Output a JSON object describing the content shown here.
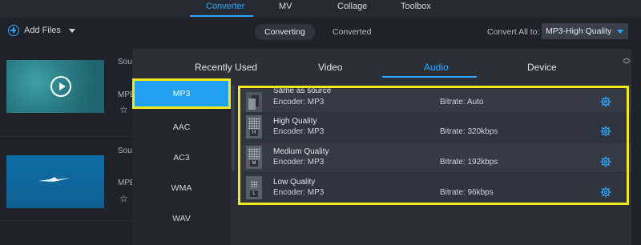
{
  "top_nav": {
    "tabs": [
      {
        "label": "Converter",
        "active": true
      },
      {
        "label": "MV",
        "active": false
      },
      {
        "label": "Collage",
        "active": false
      },
      {
        "label": "Toolbox",
        "active": false
      }
    ]
  },
  "toolbar": {
    "add_files_label": "Add Files",
    "status_tabs": [
      "Converting",
      "Converted"
    ],
    "convert_all_label": "Convert All to:",
    "convert_all_value": "MP3-High Quality"
  },
  "file_rows": [
    {
      "frag1": "Sou",
      "frag2": "MPE"
    },
    {
      "frag1": "Sou",
      "frag2": "MPE"
    }
  ],
  "format_popup": {
    "tabs": [
      {
        "label": "Recently Used",
        "active": false
      },
      {
        "label": "Video",
        "active": false
      },
      {
        "label": "Audio",
        "active": true
      },
      {
        "label": "Device",
        "active": false
      }
    ],
    "formats": [
      {
        "label": "MP3",
        "selected": true
      },
      {
        "label": "AAC",
        "selected": false
      },
      {
        "label": "AC3",
        "selected": false
      },
      {
        "label": "WMA",
        "selected": false
      },
      {
        "label": "WAV",
        "selected": false
      }
    ],
    "presets": [
      {
        "name": "Same as source",
        "encoder": "Encoder: MP3",
        "bitrate": "Bitrate: Auto",
        "icon": "file-stack-icon",
        "badge": ""
      },
      {
        "name": "High Quality",
        "encoder": "Encoder: MP3",
        "bitrate": "Bitrate: 320kbps",
        "icon": "quality-high-icon",
        "badge": "H"
      },
      {
        "name": "Medium Quality",
        "encoder": "Encoder: MP3",
        "bitrate": "Bitrate: 192kbps",
        "icon": "quality-medium-icon",
        "badge": "M"
      },
      {
        "name": "Low Quality",
        "encoder": "Encoder: MP3",
        "bitrate": "Bitrate: 96kbps",
        "icon": "quality-low-icon",
        "badge": "L"
      }
    ]
  },
  "colors": {
    "accent": "#2aa8ff",
    "highlight": "#f2ea18",
    "background": "#1f2229",
    "panel": "#2b2f38"
  }
}
